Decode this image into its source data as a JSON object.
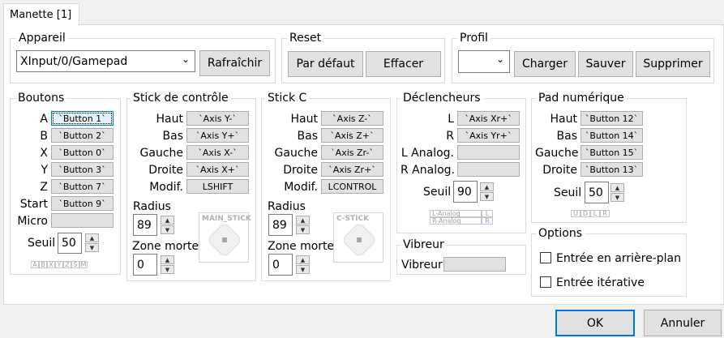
{
  "tab": {
    "label": "Manette [1]"
  },
  "appareil": {
    "title": "Appareil",
    "device": "XInput/0/Gamepad",
    "refresh": "Rafraîchir"
  },
  "reset": {
    "title": "Reset",
    "default": "Par défaut",
    "clear": "Effacer"
  },
  "profil": {
    "title": "Profil",
    "value": "",
    "load": "Charger",
    "save": "Sauver",
    "delete": "Supprimer"
  },
  "boutons": {
    "title": "Boutons",
    "rows": [
      {
        "label": "A",
        "value": "`Button 1`"
      },
      {
        "label": "B",
        "value": "`Button 2`"
      },
      {
        "label": "X",
        "value": "`Button 0`"
      },
      {
        "label": "Y",
        "value": "`Button 3`"
      },
      {
        "label": "Z",
        "value": "`Button 7`"
      },
      {
        "label": "Start",
        "value": "`Button 9`"
      },
      {
        "label": "Micro",
        "value": ""
      }
    ],
    "seuil_label": "Seuil",
    "seuil": "50",
    "mini": [
      "A",
      "B",
      "X",
      "Y",
      "Z",
      "S",
      "M"
    ]
  },
  "stick": {
    "title": "Stick de contrôle",
    "rows": [
      {
        "label": "Haut",
        "value": "`Axis Y-`"
      },
      {
        "label": "Bas",
        "value": "`Axis Y+`"
      },
      {
        "label": "Gauche",
        "value": "`Axis X-`"
      },
      {
        "label": "Droite",
        "value": "`Axis X+`"
      },
      {
        "label": "Modif.",
        "value": "LSHIFT"
      }
    ],
    "radius_label": "Radius",
    "radius": "89",
    "zone_label": "Zone morte",
    "zone": "0",
    "diagram": "MAIN_STICK"
  },
  "cstick": {
    "title": "Stick C",
    "rows": [
      {
        "label": "Haut",
        "value": "`Axis Z-`"
      },
      {
        "label": "Bas",
        "value": "`Axis Z+`"
      },
      {
        "label": "Gauche",
        "value": "`Axis Zr-`"
      },
      {
        "label": "Droite",
        "value": "`Axis Zr+`"
      },
      {
        "label": "Modif.",
        "value": "LCONTROL"
      }
    ],
    "radius_label": "Radius",
    "radius": "89",
    "zone_label": "Zone morte",
    "zone": "0",
    "diagram": "C-STICK"
  },
  "declencheurs": {
    "title": "Déclencheurs",
    "rows": [
      {
        "label": "L",
        "value": "`Axis Xr+`"
      },
      {
        "label": "R",
        "value": "`Axis Yr+`"
      },
      {
        "label": "L Analog.",
        "value": ""
      },
      {
        "label": "R Analog.",
        "value": ""
      }
    ],
    "seuil_label": "Seuil",
    "seuil": "90",
    "mini": [
      [
        "L-Analog",
        "L"
      ],
      [
        "R-Analog",
        "R"
      ]
    ]
  },
  "vibreur": {
    "title": "Vibreur",
    "label": "Vibreur",
    "value": ""
  },
  "pad": {
    "title": "Pad numérique",
    "rows": [
      {
        "label": "Haut",
        "value": "`Button 12`"
      },
      {
        "label": "Bas",
        "value": "`Button 14`"
      },
      {
        "label": "Gauche",
        "value": "`Button 15`"
      },
      {
        "label": "Droite",
        "value": "`Button 13`"
      }
    ],
    "seuil_label": "Seuil",
    "seuil": "50",
    "mini": [
      "U",
      "D",
      "L",
      "R"
    ]
  },
  "options": {
    "title": "Options",
    "bg": "Entrée en arrière-plan",
    "iter": "Entrée itérative"
  },
  "footer": {
    "ok": "OK",
    "cancel": "Annuler"
  },
  "icons": {
    "spin": "spin-arrows",
    "dropdown": "chevron-down-icon"
  }
}
